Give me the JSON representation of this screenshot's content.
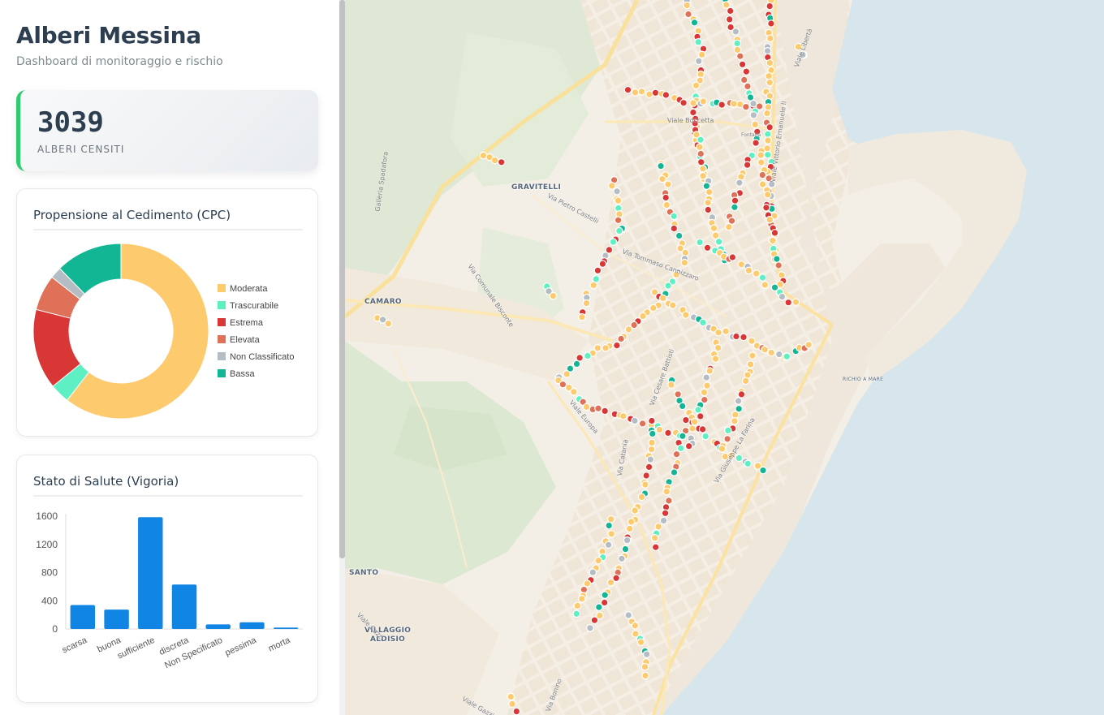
{
  "sidebar": {
    "title": "Alberi Messina",
    "subtitle": "Dashboard di monitoraggio e rischio",
    "stat": {
      "value": "3039",
      "label": "ALBERI CENSITI"
    }
  },
  "colors": {
    "moderata": "#fdca6e",
    "trascurabile": "#5ef0c2",
    "estrema": "#d93636",
    "elevata": "#e07159",
    "non_classificato": "#b4bcc4",
    "bassa": "#13b694",
    "bar": "#1185e4",
    "accent": "#2ecc71"
  },
  "chart_data": [
    {
      "type": "pie",
      "title": "Propensione al Cedimento (CPC)",
      "labels": [
        "Moderata",
        "Trascurabile",
        "Estrema",
        "Elevata",
        "Non Classificato",
        "Bassa"
      ],
      "values": [
        1840,
        110,
        450,
        200,
        65,
        374
      ],
      "legend_position": "right"
    },
    {
      "type": "bar",
      "title": "Stato di Salute (Vigoria)",
      "categories": [
        "scarsa",
        "buona",
        "sufficiente",
        "discreta",
        "Non Specificato",
        "pessima",
        "morta"
      ],
      "values": [
        340,
        275,
        1585,
        630,
        65,
        95,
        20
      ],
      "ylim": [
        0,
        1600
      ],
      "yticks": [
        "0",
        "400",
        "800",
        "1200",
        "1600"
      ],
      "grid": false
    }
  ],
  "map": {
    "place_labels": [
      "GRAVITELLI",
      "CAMARO",
      "SANTO",
      "VILLAGGIO",
      "ALDISIO",
      "RICHIO A MARE"
    ],
    "street_labels": [
      "Viale Boccetta",
      "Via Pietro Castelli",
      "Via Tommaso Cannizzaro",
      "Via Comunale Bisconte",
      "Galleria Spadafora",
      "Viale Europa",
      "Via Cesare Battisti",
      "Via Giuseppe La Farina",
      "Viale Vittorio Emanuele II",
      "Viale Cazzi",
      "Viale Gazzi",
      "Via Catania",
      "Viale Libertà",
      "Fontana",
      "Via Bonino"
    ]
  }
}
